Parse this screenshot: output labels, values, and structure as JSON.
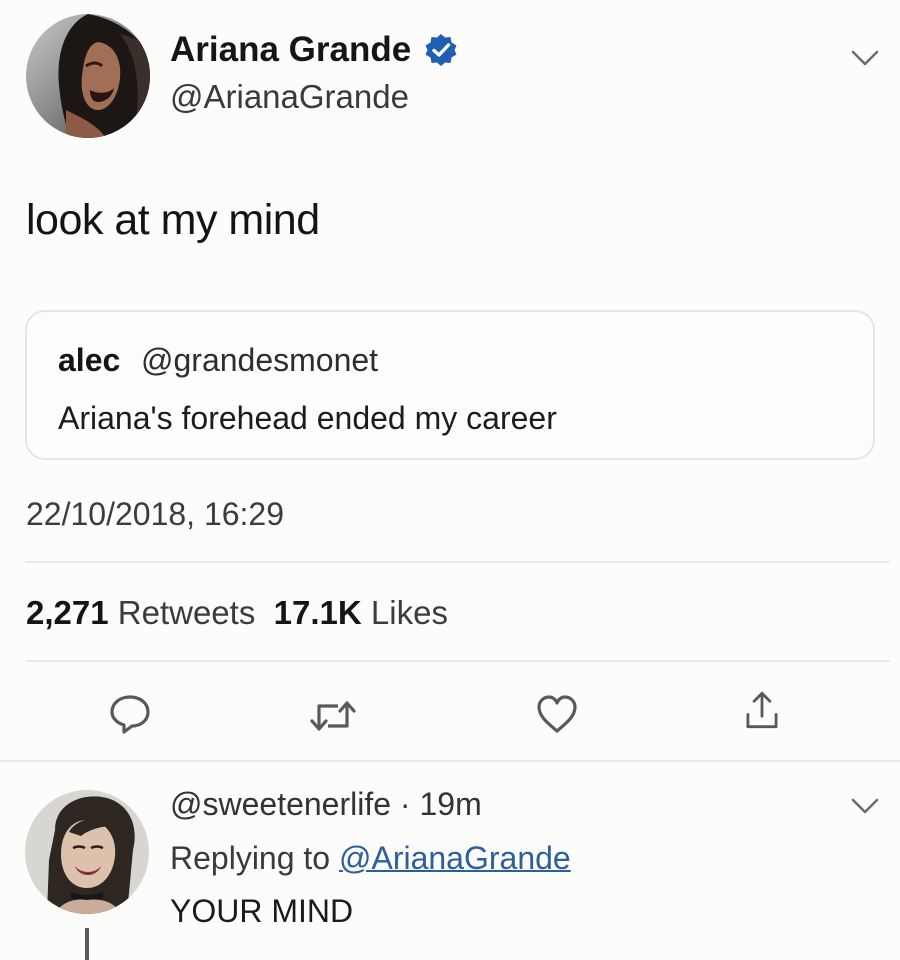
{
  "tweet": {
    "author_name": "Ariana Grande",
    "author_handle": "@ArianaGrande",
    "verified_icon": "verified-badge-icon",
    "text": "look at my mind",
    "quote": {
      "author_name": "alec",
      "author_handle": "@grandesmonet",
      "text": "Ariana's forehead ended my career"
    },
    "timestamp": "22/10/2018, 16:29",
    "stats": {
      "retweets_count": "2,271",
      "retweets_label": "Retweets",
      "likes_count": "17.1K",
      "likes_label": "Likes"
    },
    "actions": [
      "reply-icon",
      "retweet-icon",
      "like-icon",
      "share-icon"
    ]
  },
  "reply": {
    "handle_time": "@sweetenerlife · 19m",
    "replying_prefix": "Replying to ",
    "replying_mention": "@ArianaGrande",
    "text": "YOUR MIND"
  },
  "colors": {
    "background": "#fcfcfa",
    "verified_blue": "#1e5fb3",
    "link_blue": "#2c5f9e",
    "divider": "#e8e9e9",
    "icon_gray": "#555a60"
  }
}
